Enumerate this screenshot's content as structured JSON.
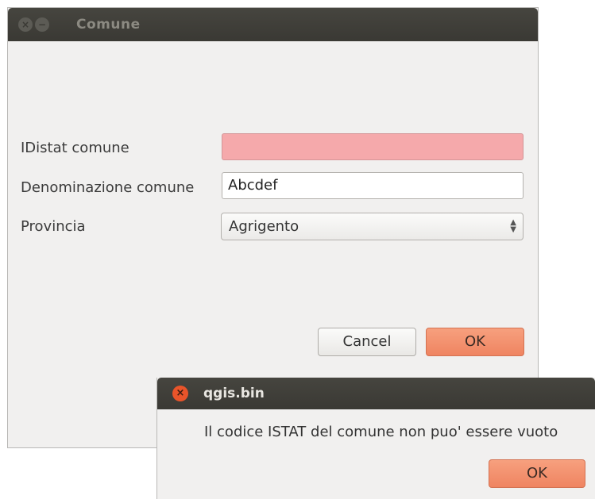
{
  "dialog": {
    "title": "Comune",
    "fields": {
      "idistat_label": "IDistat comune",
      "idistat_value": "",
      "denominazione_label": "Denominazione comune",
      "denominazione_value": "Abcdef",
      "provincia_label": "Provincia",
      "provincia_value": "Agrigento"
    },
    "buttons": {
      "cancel_label": "Cancel",
      "ok_label": "OK"
    },
    "colors": {
      "error_field": "#f5a9ab",
      "accent_button": "#ef8461"
    }
  },
  "message_box": {
    "title": "qgis.bin",
    "message": "Il codice ISTAT del comune non puo' essere vuoto",
    "ok_label": "OK",
    "close_icon": "close-icon"
  },
  "icons": {
    "titlebar_close": "close-icon",
    "titlebar_minimize": "minimize-icon",
    "combo_spinner": "chevron-up-down-icon"
  }
}
